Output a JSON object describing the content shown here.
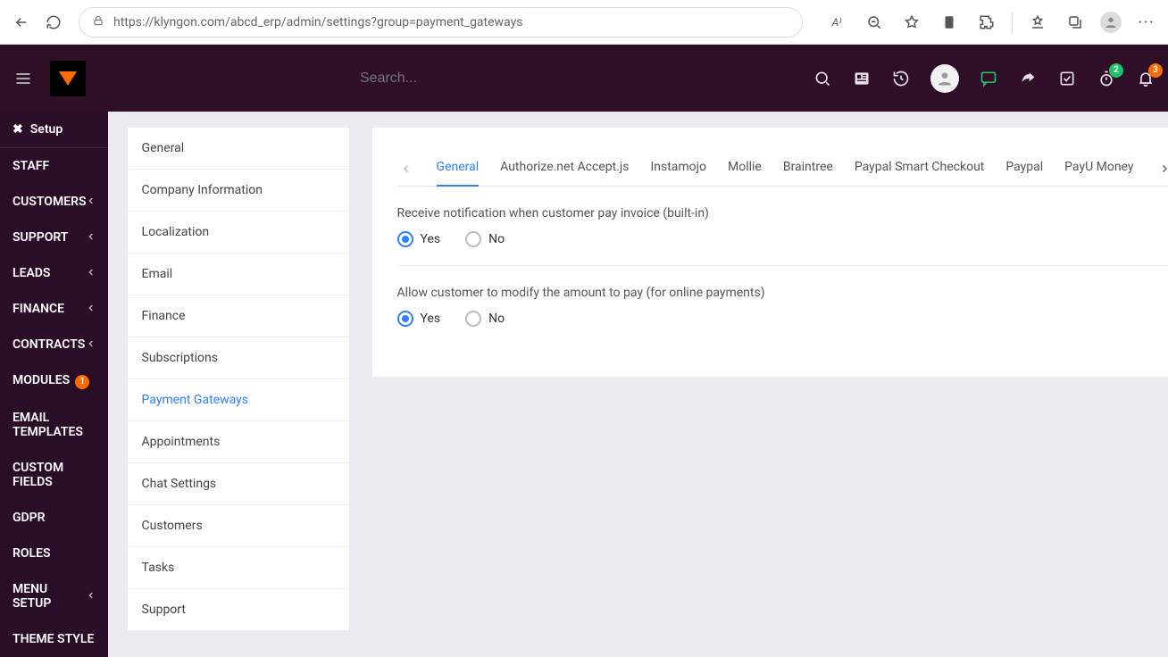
{
  "browser": {
    "url": "https://klyngon.com/abcd_erp/admin/settings?group=payment_gateways"
  },
  "topbar": {
    "search_placeholder": "Search...",
    "stopwatch_badge": "2",
    "bell_badge": "3"
  },
  "sidebar": {
    "header": "Setup",
    "items": [
      {
        "label": "STAFF",
        "chevron": false
      },
      {
        "label": "CUSTOMERS",
        "chevron": true
      },
      {
        "label": "SUPPORT",
        "chevron": true
      },
      {
        "label": "LEADS",
        "chevron": true
      },
      {
        "label": "FINANCE",
        "chevron": true
      },
      {
        "label": "CONTRACTS",
        "chevron": true
      },
      {
        "label": "MODULES",
        "chevron": false,
        "badge": "1"
      },
      {
        "label": "EMAIL TEMPLATES",
        "chevron": false
      },
      {
        "label": "CUSTOM FIELDS",
        "chevron": false
      },
      {
        "label": "GDPR",
        "chevron": false
      },
      {
        "label": "ROLES",
        "chevron": false
      },
      {
        "label": "MENU SETUP",
        "chevron": true
      },
      {
        "label": "THEME STYLE",
        "chevron": false
      }
    ]
  },
  "settings_nav": {
    "items": [
      "General",
      "Company Information",
      "Localization",
      "Email",
      "Finance",
      "Subscriptions",
      "Payment Gateways",
      "Appointments",
      "Chat Settings",
      "Customers",
      "Tasks",
      "Support"
    ],
    "active_index": 6
  },
  "tabs": {
    "items": [
      "General",
      "Authorize.net Accept.js",
      "Instamojo",
      "Mollie",
      "Braintree",
      "Paypal Smart Checkout",
      "Paypal",
      "PayU Money"
    ],
    "active_index": 0
  },
  "settings": {
    "notify_label": "Receive notification when customer pay invoice (built-in)",
    "notify_yes": "Yes",
    "notify_no": "No",
    "modify_label": "Allow customer to modify the amount to pay (for online payments)",
    "modify_yes": "Yes",
    "modify_no": "No"
  }
}
